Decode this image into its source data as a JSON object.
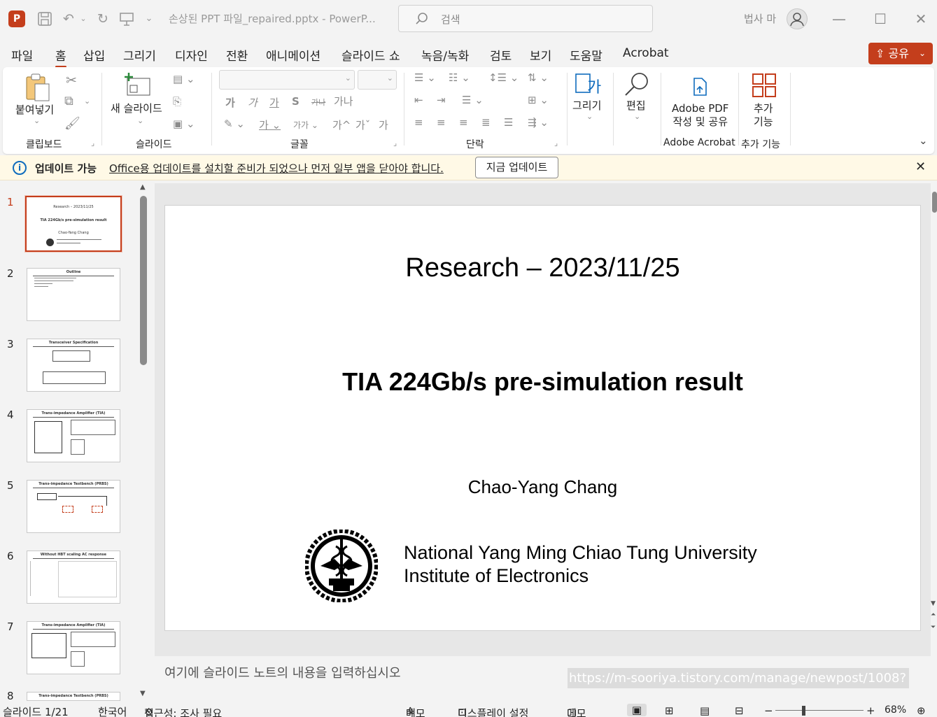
{
  "app": {
    "logo_letter": "P",
    "title": "손상된 PPT 파일_repaired.pptx  -  PowerP...",
    "search_placeholder": "검색",
    "user_name": "법사 마"
  },
  "menu": {
    "tabs": [
      "파일",
      "홈",
      "삽입",
      "그리기",
      "디자인",
      "전환",
      "애니메이션",
      "슬라이드 쇼",
      "녹음/녹화",
      "검토",
      "보기",
      "도움말",
      "Acrobat"
    ],
    "active": "홈",
    "share_label": "공유"
  },
  "ribbon": {
    "paste_label": "붙여넣기",
    "clipboard_group": "클립보드",
    "new_slide_label": "새 슬라이드",
    "slides_group": "슬라이드",
    "font_group": "글꼴",
    "paragraph_group": "단락",
    "drawing_label": "그리기",
    "editing_label": "편집",
    "adobe_pdf_label_1": "Adobe PDF",
    "adobe_pdf_label_2": "작성 및 공유",
    "adobe_group": "Adobe Acrobat",
    "addins_label_1": "추가",
    "addins_label_2": "기능",
    "addins_group": "추가 기능",
    "font_btns": {
      "bold": "가",
      "italic": "가",
      "underline": "가",
      "strike": "S",
      "strike2": "가나",
      "spacing": "가나",
      "case": "가가",
      "grow": "가^",
      "shrink": "가ˇ",
      "clear": "가"
    }
  },
  "notification": {
    "title": "업데이트 가능",
    "message": "Office용 업데이트를 설치할 준비가 되었으나 먼저 일부 앱을 닫아야 합니다.",
    "button": "지금 업데이트"
  },
  "thumbnails": [
    {
      "num": "1",
      "title": "Research – 2023/11/25",
      "subtitle": "TIA 224Gb/s pre-simulation result",
      "author": "Chao-Yang Chang",
      "selected": true
    },
    {
      "num": "2",
      "title": "Outline",
      "selected": false
    },
    {
      "num": "3",
      "title": "Transceiver Specification",
      "selected": false
    },
    {
      "num": "4",
      "title": "Trans-impedance Amplifier (TIA)",
      "selected": false
    },
    {
      "num": "5",
      "title": "Trans-impedance Testbench (PRBS)",
      "selected": false
    },
    {
      "num": "6",
      "title": "Without HBT scaling AC response",
      "selected": false
    },
    {
      "num": "7",
      "title": "Trans-impedance Amplifier (TIA)",
      "selected": false
    },
    {
      "num": "8",
      "title": "Trans-impedance Testbench (PRBS)",
      "selected": false
    }
  ],
  "slide": {
    "title": "Research – 2023/11/25",
    "subtitle": "TIA 224Gb/s pre-simulation result",
    "author": "Chao-Yang Chang",
    "affiliation_1": "National Yang Ming Chiao Tung University",
    "affiliation_2": "Institute of Electronics"
  },
  "notes": {
    "placeholder": "여기에 슬라이드 노트의 내용을 입력하십시오"
  },
  "overlay_url": "https://m-sooriya.tistory.com/manage/newpost/1008?",
  "status": {
    "slide_pos": "슬라이드 1/21",
    "language": "한국어",
    "accessibility": "접근성: 조사 필요",
    "notes_btn": "메모",
    "display_btn": "디스플레이 설정",
    "comments_btn": "메모",
    "zoom_minus": "−",
    "zoom_plus": "+",
    "zoom": "68%"
  },
  "colors": {
    "accent": "#c43e1c",
    "info": "#0f6cbd",
    "notif_bg": "#fff9e6"
  }
}
